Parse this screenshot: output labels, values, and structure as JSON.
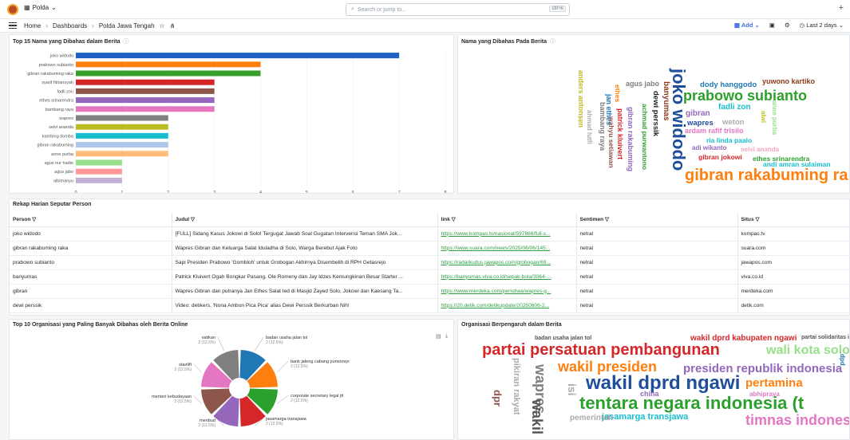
{
  "topbar": {
    "org": "Polda",
    "search_placeholder": "Search or jump to...",
    "shortcut": "ctrl+k"
  },
  "nav": {
    "crumbs": [
      "Home",
      "Dashboards",
      "Polda Jawa Tengah"
    ],
    "add": "Add",
    "time": "Last 2 days"
  },
  "panels": {
    "top15": "Top 15 Nama yang Dibahas dalam Berita",
    "cloud_names": "Nama yang Dibahas Pada Berita",
    "rekap": "Rekap Harian Seputar Person",
    "top10org": "Top 10 Organisasi yang Paling Banyak Dibahas oleh Berita Online",
    "cloud_org": "Organisasi Berpengaruh dalam Berita"
  },
  "chart_data": [
    {
      "type": "bar",
      "orientation": "horizontal",
      "title": "Top 15 Nama yang Dibahas dalam Berita",
      "categories": [
        "joko widodo",
        "prabowo subianto",
        "gibran rakabuming raka",
        "syarif fitriansyah",
        "fadli zon",
        "ethes srinarendra",
        "bambang raya",
        "wapres",
        "selvi ananda",
        "kambing domba",
        "gibran rakabuming",
        "anne purba",
        "agus nur hadie",
        "agus jabo",
        "albimanyu"
      ],
      "values": [
        7,
        4,
        4,
        3,
        3,
        3,
        3,
        2,
        2,
        2,
        2,
        2,
        1,
        1,
        1
      ],
      "colors": [
        "#1f60c4",
        "#ff7f0e",
        "#37a02c",
        "#d62728",
        "#8c564b",
        "#9467bd",
        "#e377c2",
        "#7f7f7f",
        "#bcbd22",
        "#17becf",
        "#aec7e8",
        "#ffbb78",
        "#98df8a",
        "#ff9896",
        "#c5b0d5"
      ],
      "xlim": [
        0,
        8
      ],
      "xticks": [
        0,
        1,
        2,
        3,
        4,
        5,
        6,
        7,
        8
      ]
    },
    {
      "type": "pie",
      "title": "Top 10 Organisasi yang Paling Banyak Dibahas oleh Berita Online",
      "slices": [
        {
          "label": "badan usaha jalan tol",
          "value": 2,
          "pct": "2 (12.5%)",
          "color": "#1f77b4"
        },
        {
          "label": "bank jateng cabang purworejo",
          "value": 2,
          "pct": "2 (12.5%)",
          "color": "#ff7f0e"
        },
        {
          "label": "corporate secretary legal jtt",
          "value": 2,
          "pct": "2 (12.5%)",
          "color": "#2ca02c"
        },
        {
          "label": "jasamarga transjawa",
          "value": 2,
          "pct": "2 (12.5%)",
          "color": "#d62728"
        },
        {
          "label": "menbud",
          "value": 2,
          "pct": "2 (12.5%)",
          "color": "#9467bd"
        },
        {
          "label": "menteri kebudayaan",
          "value": 2,
          "pct": "2 (12.5%)",
          "color": "#8c564b"
        },
        {
          "label": "stairlift",
          "value": 2,
          "pct": "2 (12.5%)",
          "color": "#e377c2"
        },
        {
          "label": "vatikan",
          "value": 2,
          "pct": "2 (12.5%)",
          "color": "#7f7f7f"
        }
      ]
    }
  ],
  "table": {
    "headers": [
      "Person",
      "Judul",
      "link",
      "Sentimen",
      "Situs"
    ],
    "rows": [
      [
        "joko widodo",
        "[FULL] Sidang Kasus Jokowi di Solo! Tergugat Jawab Soal Gugatan Intervensi Teman SMA Jok...",
        "https://www.kompas.tv/nasional/597866/full-s...",
        "netral",
        "kompas.tv"
      ],
      [
        "gibran rakabuming raka",
        "Wapres Gibran dan Keluarga Salat Iduladha di Solo, Warga Berebut Ajak Foto",
        "https://www.suara.com/news/2025/06/06/145...",
        "netral",
        "suara.com"
      ],
      [
        "prabowo subianto",
        "Sapi Presiden Prabowo 'Gombloh' untuk Grobogan Akhirnya Disembelih di RPH Getasrejo",
        "https://radarkudus.jawapos.com/grobogan/69...",
        "netral",
        "jawapos.com"
      ],
      [
        "banyumas",
        "Patrick Kluivert Ogah Bongkar Pasang, Ole Romeny dan Jay Idzes Kemungkinan Besar Starter ...",
        "https://banyumas.viva.co.id/sepak-bola/3064-...",
        "netral",
        "viva.co.id"
      ],
      [
        "gibran",
        "Wapres Gibran dan putranya Jan Ethes Salat Ied di Masjid Zayed Solo, Jokowi dan Kaesang Ta...",
        "https://www.merdeka.com/peristiwa/wapres-g...",
        "netral",
        "merdeka.com"
      ],
      [
        "dewi perssik",
        "Video: detikers, 'Nona Ambon Pica Pica' alias Dewi Perssik Berkurban Nih!",
        "https://20.detik.com/detikupdate/20250606-2...",
        "netral",
        "detik.com"
      ]
    ]
  },
  "cloud_names": [
    {
      "t": "joko widodo",
      "c": "#1f4e9c"
    },
    {
      "t": "prabowo subianto",
      "c": "#2ca02c"
    },
    {
      "t": "gibran rakabuming raka",
      "c": "#ff7f0e"
    },
    {
      "t": "yuwono kartiko",
      "c": "#8c3b1c"
    },
    {
      "t": "dody hanggodo",
      "c": "#1f77b4"
    },
    {
      "t": "agus jabo",
      "c": "#7f7f7f"
    },
    {
      "t": "fadli zon",
      "c": "#17becf"
    },
    {
      "t": "gibran",
      "c": "#9467bd"
    },
    {
      "t": "wapres",
      "c": "#1f4e9c"
    },
    {
      "t": "weton",
      "c": "#aaaaaa"
    },
    {
      "t": "ardam rafif trisilo",
      "c": "#e377c2"
    },
    {
      "t": "ria linda paalo",
      "c": "#17becf"
    },
    {
      "t": "adi wikanto",
      "c": "#9467bd"
    },
    {
      "t": "selvi ananda",
      "c": "#f4a6c4"
    },
    {
      "t": "gibran jokowi",
      "c": "#d62728"
    },
    {
      "t": "ethes srinarendra",
      "c": "#2ca02c"
    },
    {
      "t": "andi amran sulaiman",
      "c": "#17becf"
    },
    {
      "t": "banyumas",
      "c": "#8c3b1c"
    },
    {
      "t": "dewi perssik",
      "c": "#1f1f1f"
    },
    {
      "t": "achmad purwantono",
      "c": "#2ca02c"
    },
    {
      "t": "gibran rakabuming",
      "c": "#9467bd"
    },
    {
      "t": "patrick kluivert",
      "c": "#d62728"
    },
    {
      "t": "ethes",
      "c": "#ff7f0e"
    },
    {
      "t": "bambang raya",
      "c": "#7f7f7f"
    },
    {
      "t": "jan ethes",
      "c": "#1f77b4"
    },
    {
      "t": "ahmad lutfi",
      "c": "#aaaaaa"
    },
    {
      "t": "anders antonsen",
      "c": "#bcbd22"
    },
    {
      "t": "anne purba",
      "c": "#98df8a"
    },
    {
      "t": "alwi",
      "c": "#bcbd22"
    },
    {
      "t": "wahyu setiawan",
      "c": "#8c564b"
    }
  ],
  "cloud_org": [
    {
      "t": "wakil dprd ngawi",
      "c": "#1f4e9c"
    },
    {
      "t": "tentara negara indonesia (t",
      "c": "#2ca02c"
    },
    {
      "t": "partai persatuan pembangunan",
      "c": "#d62728"
    },
    {
      "t": "wakil presiden",
      "c": "#ff7f0e"
    },
    {
      "t": "presiden republik indonesia",
      "c": "#9467bd"
    },
    {
      "t": "wali kota solo",
      "c": "#98df8a"
    },
    {
      "t": "timnas indonesia",
      "c": "#e377c2"
    },
    {
      "t": "pertamina",
      "c": "#ff7f0e"
    },
    {
      "t": "jasamarga transjawa",
      "c": "#17becf"
    },
    {
      "t": "wakil dprd kabupaten ngawi",
      "c": "#d62728"
    },
    {
      "t": "wapres",
      "c": "#7f7f7f"
    },
    {
      "t": "wakil",
      "c": "#555555"
    },
    {
      "t": "pikiran rakyat",
      "c": "#aaaaaa"
    },
    {
      "t": "dpr",
      "c": "#8c564b"
    },
    {
      "t": "isi",
      "c": "#aaaaaa"
    },
    {
      "t": "china",
      "c": "#9467bd"
    },
    {
      "t": "abhipraya",
      "c": "#e377c2"
    },
    {
      "t": "pemerintah",
      "c": "#aaaaaa"
    },
    {
      "t": "badan usaha jalan tol",
      "c": "#555555"
    },
    {
      "t": "partai solidaritas in",
      "c": "#555555"
    },
    {
      "t": "dpd",
      "c": "#1f77b4"
    }
  ]
}
